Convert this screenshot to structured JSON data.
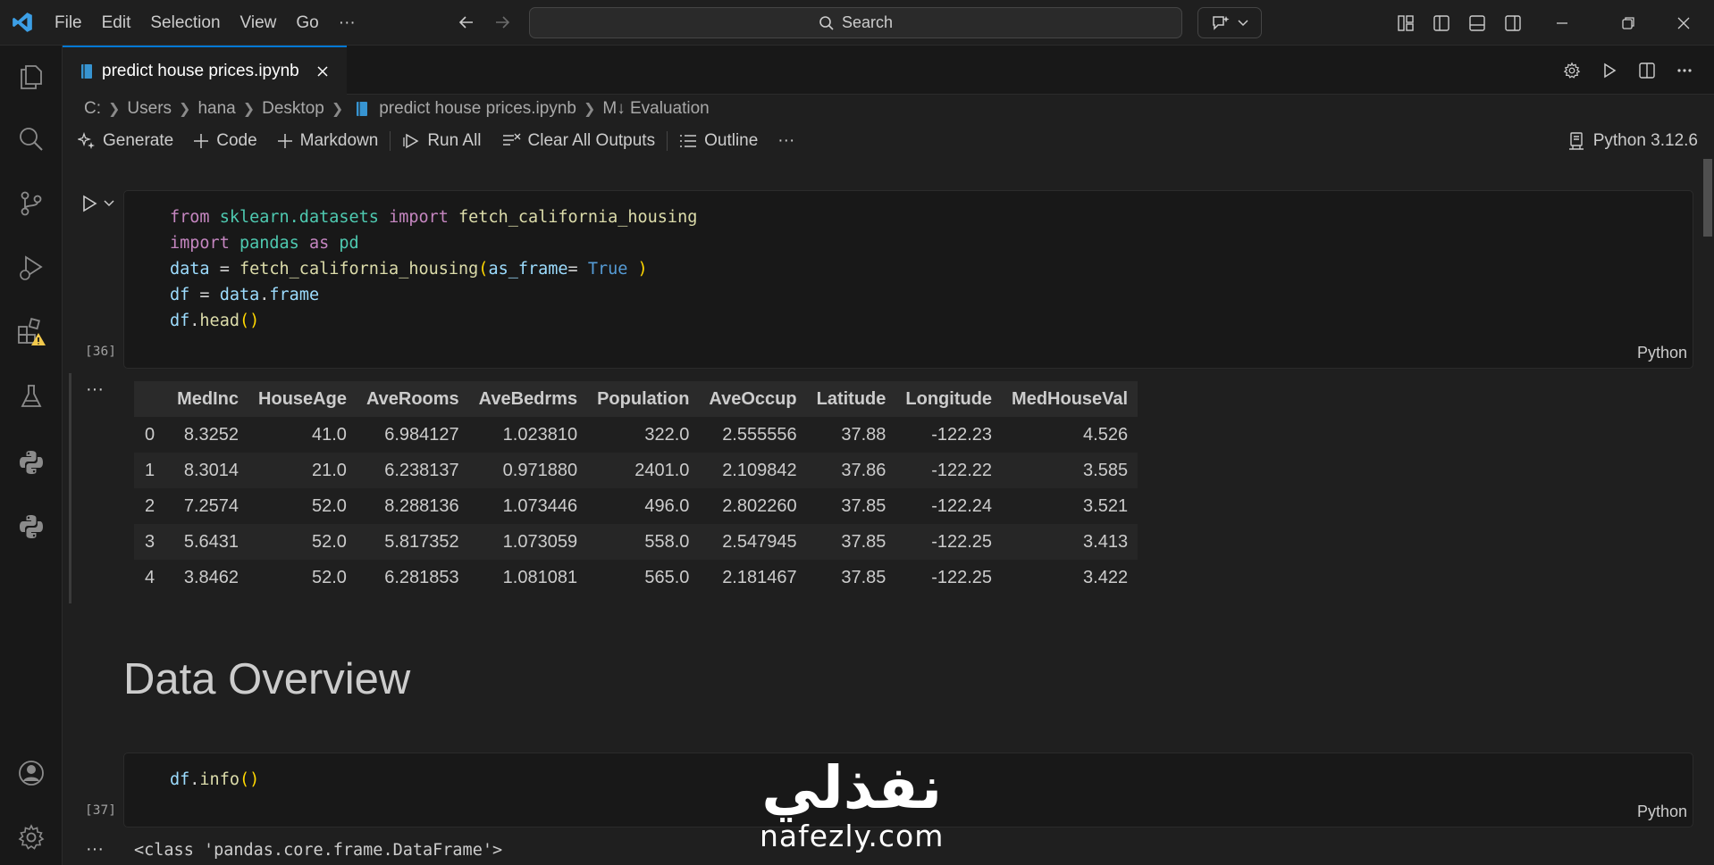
{
  "titlebar": {
    "menu": [
      "File",
      "Edit",
      "Selection",
      "View",
      "Go",
      "···"
    ],
    "search_label": "Search"
  },
  "tab": {
    "title": "predict house prices.ipynb"
  },
  "breadcrumb": [
    "C:",
    "Users",
    "hana",
    "Desktop",
    "predict house prices.ipynb",
    "M↓ Evaluation"
  ],
  "toolbar": {
    "generate": "Generate",
    "code": "Code",
    "markdown": "Markdown",
    "run_all": "Run All",
    "clear_outputs": "Clear All Outputs",
    "outline": "Outline",
    "more": "···",
    "kernel": "Python 3.12.6"
  },
  "cell1": {
    "exec_count": "[36]",
    "language": "Python",
    "lines": [
      [
        [
          "kw",
          "from"
        ],
        [
          "pl",
          " "
        ],
        [
          "mod",
          "sklearn.datasets"
        ],
        [
          "pl",
          " "
        ],
        [
          "kw",
          "import"
        ],
        [
          "pl",
          " "
        ],
        [
          "fn",
          "fetch_california_housing"
        ]
      ],
      [
        [
          "kw",
          "import"
        ],
        [
          "pl",
          " "
        ],
        [
          "mod",
          "pandas"
        ],
        [
          "pl",
          " "
        ],
        [
          "kw",
          "as"
        ],
        [
          "pl",
          " "
        ],
        [
          "mod",
          "pd"
        ]
      ],
      [
        [
          "var",
          "data"
        ],
        [
          "pl",
          " = "
        ],
        [
          "fn",
          "fetch_california_housing"
        ],
        [
          "br",
          "("
        ],
        [
          "var",
          "as_frame"
        ],
        [
          "pl",
          "= "
        ],
        [
          "con",
          "True"
        ],
        [
          "pl",
          " "
        ],
        [
          "br",
          ")"
        ]
      ],
      [
        [
          "var",
          "df"
        ],
        [
          "pl",
          " = "
        ],
        [
          "var",
          "data"
        ],
        [
          "pl",
          "."
        ],
        [
          "var",
          "frame"
        ]
      ],
      [
        [
          "var",
          "df"
        ],
        [
          "pl",
          "."
        ],
        [
          "fn",
          "head"
        ],
        [
          "br",
          "()"
        ]
      ]
    ]
  },
  "output1": {
    "more_label": "···",
    "columns": [
      "",
      "MedInc",
      "HouseAge",
      "AveRooms",
      "AveBedrms",
      "Population",
      "AveOccup",
      "Latitude",
      "Longitude",
      "MedHouseVal"
    ],
    "rows": [
      [
        "0",
        "8.3252",
        "41.0",
        "6.984127",
        "1.023810",
        "322.0",
        "2.555556",
        "37.88",
        "-122.23",
        "4.526"
      ],
      [
        "1",
        "8.3014",
        "21.0",
        "6.238137",
        "0.971880",
        "2401.0",
        "2.109842",
        "37.86",
        "-122.22",
        "3.585"
      ],
      [
        "2",
        "7.2574",
        "52.0",
        "8.288136",
        "1.073446",
        "496.0",
        "2.802260",
        "37.85",
        "-122.24",
        "3.521"
      ],
      [
        "3",
        "5.6431",
        "52.0",
        "5.817352",
        "1.073059",
        "558.0",
        "2.547945",
        "37.85",
        "-122.25",
        "3.413"
      ],
      [
        "4",
        "3.8462",
        "52.0",
        "6.281853",
        "1.081081",
        "565.0",
        "2.181467",
        "37.85",
        "-122.25",
        "3.422"
      ]
    ]
  },
  "markdown_heading": "Data Overview",
  "cell2": {
    "exec_count": "[37]",
    "language": "Python",
    "lines": [
      [
        [
          "var",
          "df"
        ],
        [
          "pl",
          "."
        ],
        [
          "fn",
          "info"
        ],
        [
          "br",
          "()"
        ]
      ]
    ]
  },
  "output2": {
    "more_label": "···",
    "text": "<class 'pandas.core.frame.DataFrame'>"
  },
  "watermark": {
    "arabic": "نفذلي",
    "latin": "nafezly.com"
  }
}
